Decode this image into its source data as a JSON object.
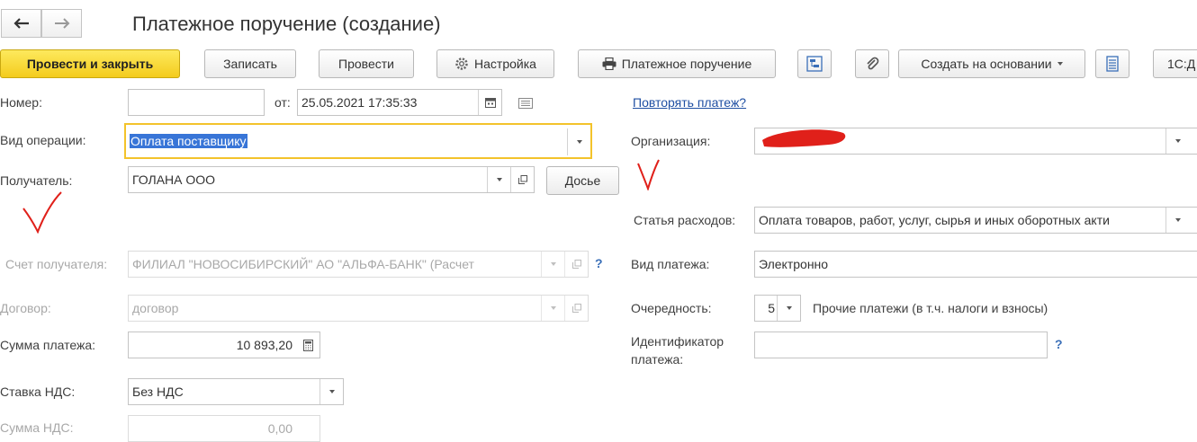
{
  "window": {
    "title": "Платежное поручение (создание)"
  },
  "toolbar": {
    "post_close_label": "Провести и закрыть",
    "save_label": "Записать",
    "post_label": "Провести",
    "settings_label": "Настройка",
    "print_label": "Платежное поручение",
    "create_based_label": "Создать на основании",
    "extra_label": "1С:Д"
  },
  "form": {
    "number": {
      "label": "Номер:",
      "value": ""
    },
    "date": {
      "label": "от:",
      "value": "25.05.2021 17:35:33"
    },
    "repeat_link": "Повторять платеж?",
    "operation": {
      "label": "Вид операции:",
      "value": "Оплата поставщику"
    },
    "organization": {
      "label": "Организация:",
      "value": ""
    },
    "recipient": {
      "label": "Получатель:",
      "value": "ГОЛАНА ООО",
      "dossier_label": "Досье"
    },
    "expense_item": {
      "label": "Статья расходов:",
      "value": "Оплата товаров, работ, услуг, сырья и иных оборотных акти"
    },
    "recipient_account": {
      "label": "Счет получателя:",
      "value": "ФИЛИАЛ \"НОВОСИБИРСКИЙ\" АО \"АЛЬФА-БАНК\" (Расчет"
    },
    "payment_type": {
      "label": "Вид платежа:",
      "value": "Электронно"
    },
    "contract": {
      "label": "Договор:",
      "value": "договор"
    },
    "priority": {
      "label": "Очередность:",
      "value": "5",
      "description": "Прочие платежи (в т.ч. налоги и взносы)"
    },
    "amount": {
      "label": "Сумма платежа:",
      "value": "10 893,20"
    },
    "payment_id": {
      "label_line1": "Идентификатор",
      "label_line2": "платежа:",
      "value": ""
    },
    "vat_rate": {
      "label": "Ставка НДС:",
      "value": "Без НДС"
    },
    "vat_amount": {
      "label": "Сумма НДС:",
      "value": "0,00"
    },
    "help_mark": "?"
  },
  "colors": {
    "primary_button": "#f4cc1d",
    "focus_border": "#f3c32b",
    "selection": "#3875d7",
    "link": "#1f4fa3",
    "annotation_red": "#e0201a"
  }
}
